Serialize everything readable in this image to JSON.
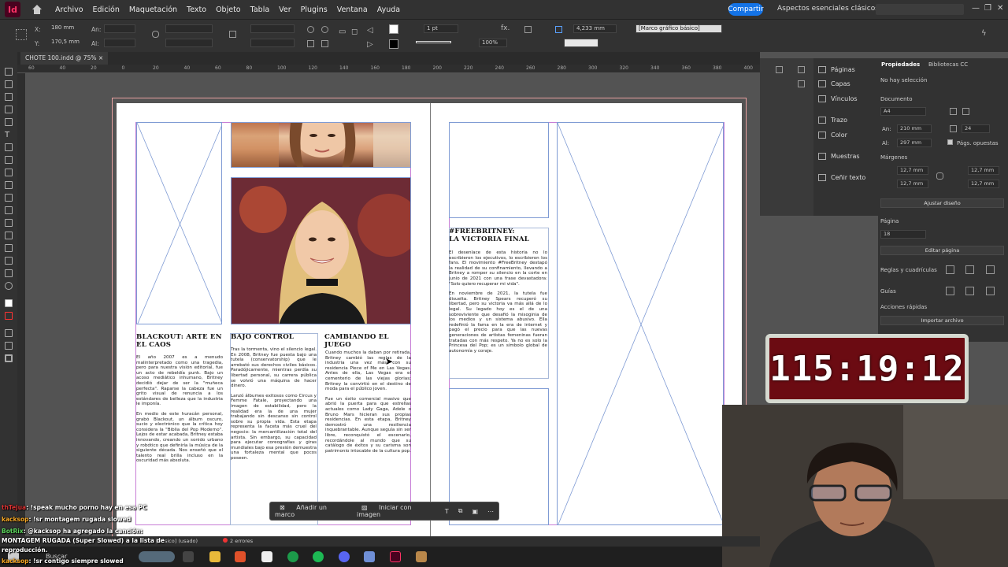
{
  "menubar": {
    "app_icon": "Id",
    "items": [
      "Archivo",
      "Edición",
      "Maquetación",
      "Texto",
      "Objeto",
      "Tabla",
      "Ver",
      "Plugins",
      "Ventana",
      "Ayuda"
    ],
    "share": "Compartir",
    "workspace": "Aspectos esenciales clásicos"
  },
  "control": {
    "x_label": "X:",
    "x_value": "180 mm",
    "y_label": "Y:",
    "y_value": "170,5 mm",
    "w_label": "An:",
    "h_label": "Al:",
    "stroke_weight": "1 pt",
    "opacity": "100%",
    "offset": "4,233 mm",
    "style": "[Marco gráfico básico]"
  },
  "doc": {
    "tab": "CHOTE 100.indd @ 75%",
    "close": "×"
  },
  "ruler": {
    "ticks": [
      "60",
      "40",
      "20",
      "0",
      "20",
      "40",
      "60",
      "80",
      "100",
      "120",
      "140",
      "160",
      "180",
      "200",
      "220",
      "240",
      "260",
      "280",
      "300",
      "320",
      "340",
      "360",
      "380",
      "400"
    ]
  },
  "layout": {
    "col1_head": "BLACKOUT: ARTE EN EL CAOS",
    "col1_body": [
      "El año 2007 es a menudo malinterpretado como una tragedia, pero para nuestra visión editorial, fue un acto de rebeldía punk. Bajo un acoso mediático inhumano, Britney decidió dejar de ser la \"muñeca perfecta\". Raparse la cabeza fue un grito visual de renuncia a los estándares de belleza que la industria le imponía.",
      "En medio de este huracán personal, grabó Blackout, un álbum oscuro, sucio y electrónico que la crítica hoy considera la \"Biblia del Pop Moderno\". Lejos de estar acabada, Britney estaba innovando, creando un sonido urbano y robótico que definiría la música de la siguiente década. Nos enseñó que el talento real brilla incluso en la oscuridad más absoluta."
    ],
    "col2_head": "BAJO CONTROL",
    "col2_body": [
      "Tras la tormenta, vino el silencio legal. En 2008, Britney fue puesta bajo una tutela (conservatorship) que le arrebató sus derechos civiles básicos. Paradójicamente, mientras perdía su libertad personal, su carrera pública se volvió una máquina de hacer dinero.",
      "Lanzó álbumes exitosos como Circus y Femme Fatale, proyectando una imagen de estabilidad, pero la realidad era la de una mujer trabajando sin descanso sin control sobre su propia vida. Esta etapa representa la faceta más cruel del negocio: la mercantilización total del artista. Sin embargo, su capacidad para ejecutar coreografías y giras mundiales bajo esa presión demuestra una fortaleza mental que pocos poseen."
    ],
    "col3_head": "CAMBIANDO EL JUEGO",
    "col3_body": [
      "Cuando muchos la daban por retirada, Britney cambió las reglas de la industria una vez más con su residencia Piece of Me en Las Vegas. Antes de ella, Las Vegas era el cementerio de las viejas glorias; Britney la convirtió en el destino de moda para el público joven.",
      "Fue un éxito comercial masivo que abrió la puerta para que estrellas actuales como Lady Gaga, Adele o Bruno Mars hicieran sus propias residencias. En esta etapa, Britney demostró una resiliencia inquebrantable. Aunque seguía sin ser libre, reconquistó el escenario, recordándole al mundo que su catálogo de éxitos y su carisma son patrimonio intocable de la cultura pop."
    ],
    "col4_head": "#FREEBRITNEY:\nLA VICTORIA FINAL",
    "col4_body": [
      "El desenlace de esta historia no lo escribieron los ejecutivos, lo escribieron los fans. El movimiento #FreeBritney destapó la realidad de su confinamiento, llevando a Britney a romper su silencio en la corte en junio de 2021 con una frase devastadora: \"Solo quiero recuperar mi vida\".",
      "En noviembre de 2021, la tutela fue disuelta. Britney Spears recuperó su libertad, pero su victoria va más allá de lo legal. Su legado hoy es el de una sobreviviente que desafió la misoginia de los medios y un sistema abusivo. Ella redefinió la fama en la era de internet y pagó el precio para que las nuevas generaciones de artistas femeninas fueran tratadas con más respeto. Ya no es solo la Princesa del Pop; es un símbolo global de autonomía y coraje."
    ]
  },
  "panels": {
    "items": [
      "Páginas",
      "Capas",
      "Vínculos",
      "Trazo",
      "Color",
      "Muestras",
      "Ceñir texto"
    ]
  },
  "props": {
    "tab1": "Propiedades",
    "tab2": "Bibliotecas CC",
    "nosel": "No hay selección",
    "doc_label": "Documento",
    "size": "A4",
    "w_label": "An:",
    "w": "210 mm",
    "h_label": "Al:",
    "h": "297 mm",
    "pages": "24",
    "facing": "Págs. opuestas",
    "margins": "Márgenes",
    "m1": "12,7 mm",
    "m2": "12,7 mm",
    "m3": "12,7 mm",
    "m4": "12,7 mm",
    "adjust": "Ajustar diseño",
    "page_label": "Página",
    "page": "18",
    "edit_page": "Editar página",
    "rulers": "Reglas y cuadrículas",
    "guides": "Guías",
    "quick": "Acciones rápidas",
    "import": "Importar archivo"
  },
  "timer": "115:19:12",
  "ctx": {
    "add": "Añadir un marco",
    "start": "Iniciar con imagen"
  },
  "status": {
    "style": "[Básico] (usado)",
    "errors": "2 errores"
  },
  "taskbar": {
    "search": "Buscar"
  },
  "chat": [
    {
      "user": "thTejua",
      "msg": ": !speak mucho porno hay en esa PC"
    },
    {
      "user": "kacksop",
      "msg": ": !sr montagem rugada slowed"
    },
    {
      "user": "BotRix",
      "msg": ": @kacksop ha agregado la canción:"
    },
    {
      "user": "",
      "msg": "MONTAGEM RUGADA (Super Slowed) a la lista de"
    },
    {
      "user": "",
      "msg": "reproducción."
    },
    {
      "user": "kacksop",
      "msg": ": !sr contigo siempre slowed"
    }
  ]
}
